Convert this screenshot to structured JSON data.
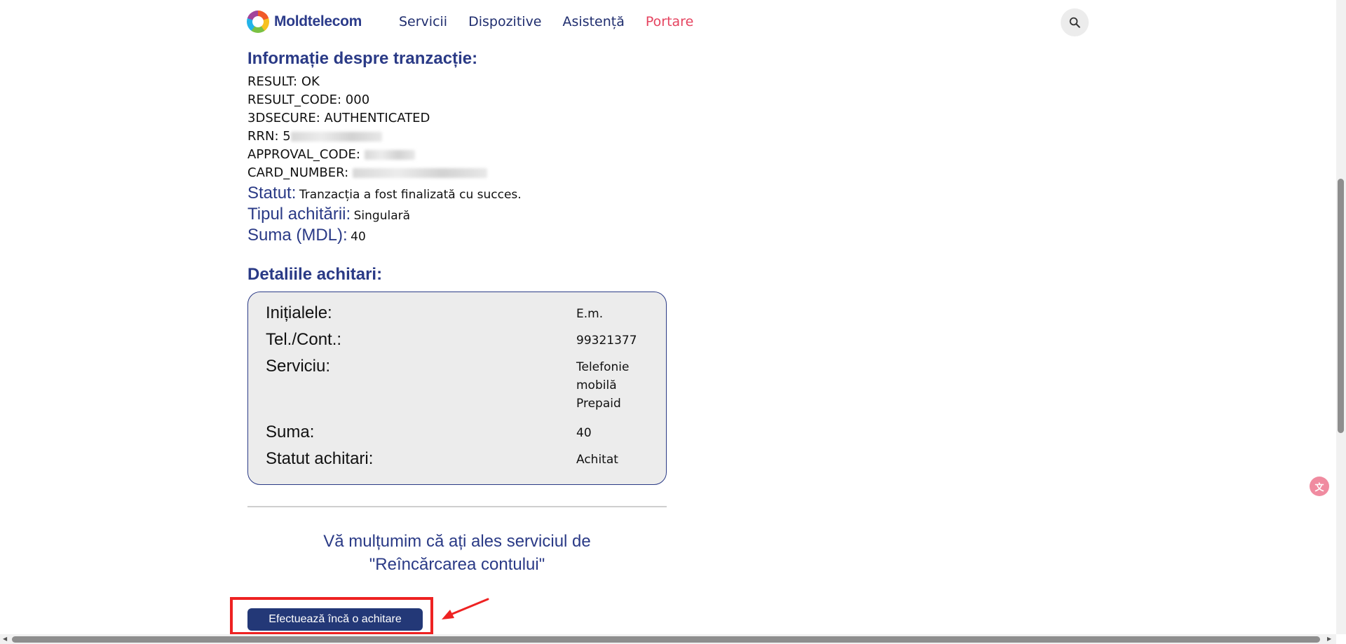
{
  "header": {
    "logo_text": "Moldtelecom",
    "nav": [
      {
        "label": "Servicii"
      },
      {
        "label": "Dispozitive"
      },
      {
        "label": "Asistență"
      },
      {
        "label": "Portare"
      }
    ],
    "accent_color": "#e5435f",
    "brand_color": "#2a3a86"
  },
  "transaction": {
    "title": "Informație despre tranzacție:",
    "lines": [
      {
        "label": "RESULT:",
        "value": "OK"
      },
      {
        "label": "RESULT_CODE:",
        "value": "000"
      },
      {
        "label": "3DSECURE:",
        "value": "AUTHENTICATED"
      },
      {
        "label": "RRN:",
        "value": "5"
      },
      {
        "label": "APPROVAL_CODE:",
        "value": ""
      },
      {
        "label": "CARD_NUMBER:",
        "value": ""
      }
    ],
    "status_label": "Statut:",
    "status_value": "Tranzacția a fost finalizată cu succes.",
    "type_label": "Tipul achitării:",
    "type_value": "Singulară",
    "sum_label": "Suma (MDL):",
    "sum_value": "40"
  },
  "details": {
    "title": "Detaliile achitari:",
    "rows": [
      {
        "label": "Inițialele:",
        "value": "E.m."
      },
      {
        "label": "Tel./Cont.:",
        "value": "99321377"
      },
      {
        "label": "Serviciu:",
        "value": "Telefonie mobilă Prepaid"
      },
      {
        "label": "Suma:",
        "value": "40"
      },
      {
        "label": "Statut achitari:",
        "value": "Achitat"
      }
    ]
  },
  "thanks": {
    "line1": "Vă mulțumim că ați ales serviciul de",
    "line2": "\"Reîncărcarea contului\""
  },
  "actions": {
    "repeat_payment_label": "Efectuează încă o achitare"
  },
  "widgets": {
    "translate_icon": "translate-icon",
    "search_icon": "search-icon"
  }
}
